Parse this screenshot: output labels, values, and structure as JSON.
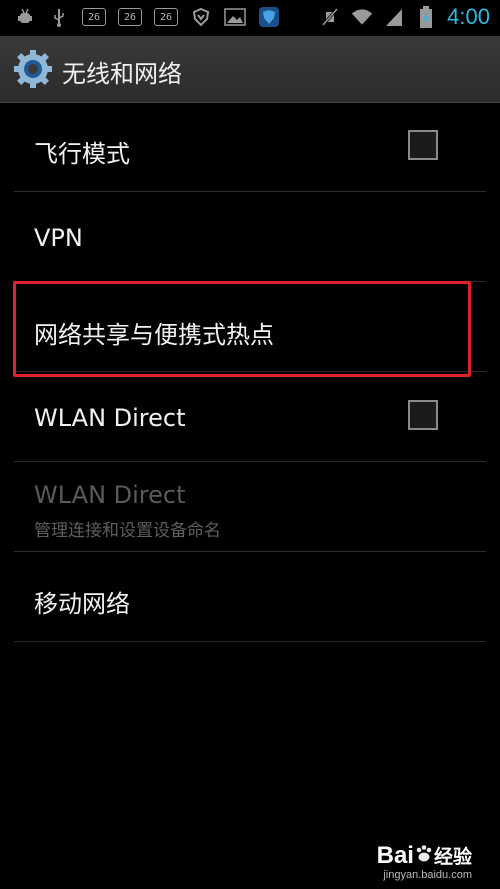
{
  "status_bar": {
    "badges": [
      "26",
      "26",
      "26"
    ],
    "time": "4:00",
    "time_color": "#33b5e5",
    "icons": [
      "usb-debug-icon",
      "usb-icon",
      "download-icon",
      "shield-icon",
      "image-icon",
      "security-app-icon",
      "mute-icon",
      "wifi-icon",
      "signal-icon",
      "battery-charging-icon"
    ]
  },
  "action_bar": {
    "title": "无线和网络",
    "icon": "settings-gear-icon"
  },
  "list": {
    "items": [
      {
        "label": "飞行模式",
        "has_checkbox": true,
        "checked": false
      },
      {
        "label": "VPN"
      },
      {
        "label": "网络共享与便携式热点",
        "highlighted": true,
        "highlight_color": "#e0202a"
      },
      {
        "label": "WLAN Direct",
        "has_checkbox": true,
        "checked": false
      },
      {
        "label": "WLAN Direct",
        "subtitle": "管理连接和设置设备命名",
        "disabled": true
      },
      {
        "label": "移动网络"
      }
    ]
  },
  "watermark": {
    "brand": "Bai",
    "brand_suffix": "经验",
    "url": "jingyan.baidu.com"
  }
}
